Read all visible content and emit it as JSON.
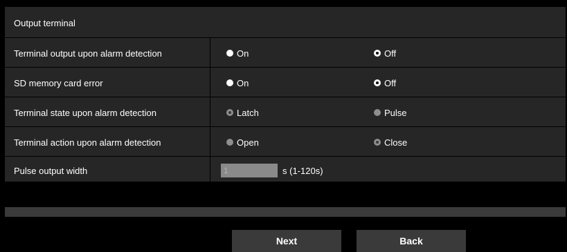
{
  "section_title": "Output terminal",
  "rows": [
    {
      "label": "Terminal output upon alarm detection",
      "options": [
        "On",
        "Off"
      ],
      "selected": "Off",
      "disabled": false
    },
    {
      "label": "SD memory card error",
      "options": [
        "On",
        "Off"
      ],
      "selected": "Off",
      "disabled": false
    },
    {
      "label": "Terminal state upon alarm detection",
      "options": [
        "Latch",
        "Pulse"
      ],
      "selected": "Latch",
      "disabled": true
    },
    {
      "label": "Terminal action upon alarm detection",
      "options": [
        "Open",
        "Close"
      ],
      "selected": "Close",
      "disabled": true
    }
  ],
  "pulse": {
    "label": "Pulse output width",
    "value": "1",
    "unit": "s (1-120s)"
  },
  "buttons": {
    "next": "Next",
    "back": "Back"
  }
}
